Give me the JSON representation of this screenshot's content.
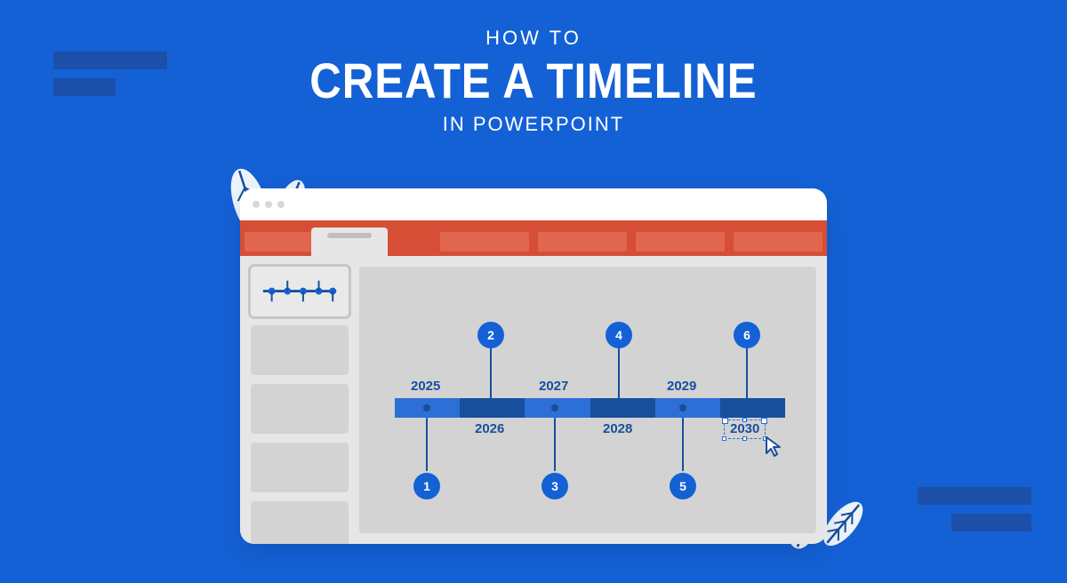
{
  "heading": {
    "line1": "HOW TO",
    "line2": "CREATE A TIMELINE",
    "line3": "IN POWERPOINT"
  },
  "timeline": {
    "years": [
      "2025",
      "2026",
      "2027",
      "2028",
      "2029",
      "2030"
    ],
    "numbers": [
      "1",
      "2",
      "3",
      "4",
      "5",
      "6"
    ],
    "selected_year": "2030"
  }
}
